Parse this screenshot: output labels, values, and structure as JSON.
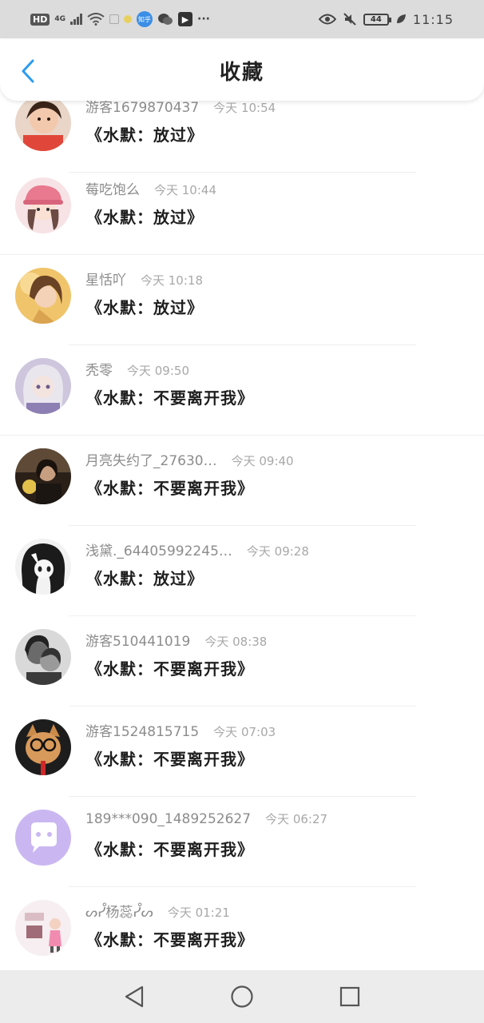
{
  "status_bar": {
    "hd": "HD",
    "network": "4G",
    "app_zhihu": "知乎",
    "more": "···",
    "battery": "44",
    "time": "11:15",
    "icons": [
      "signal-icon",
      "wifi-icon",
      "zhihu-app-icon",
      "wechat-icon",
      "douyin-icon",
      "eye-icon",
      "mute-icon",
      "battery-icon",
      "leaf-icon"
    ]
  },
  "header": {
    "title": "收藏",
    "back_icon": "chevron-left-icon",
    "accent_color": "#2b9cf0"
  },
  "items": [
    {
      "username": "游客1679870437",
      "time": "今天 10:54",
      "message": "《水默：放过》",
      "avatar": "photo-girl"
    },
    {
      "username": "莓吃饱么",
      "time": "今天 10:44",
      "message": "《水默：放过》",
      "avatar": "anime-pink-hat"
    },
    {
      "username": "星恬吖",
      "time": "今天 10:18",
      "message": "《水默：放过》",
      "avatar": "anime-golden"
    },
    {
      "username": "秃零",
      "time": "今天 09:50",
      "message": "《水默：不要离开我》",
      "avatar": "anime-silver"
    },
    {
      "username": "月亮失约了_27630…",
      "time": "今天 09:40",
      "message": "《水默：不要离开我》",
      "avatar": "photo-dark"
    },
    {
      "username": "浅黛._64405992245…",
      "time": "今天 09:28",
      "message": "《水默：放过》",
      "avatar": "anime-bw"
    },
    {
      "username": "游客510441019",
      "time": "今天 08:38",
      "message": "《水默：不要离开我》",
      "avatar": "photo-bw-couple"
    },
    {
      "username": "游客1524815715",
      "time": "今天 07:03",
      "message": "《水默：不要离开我》",
      "avatar": "cat-glasses"
    },
    {
      "username": "189***090_1489252627",
      "time": "今天 06:27",
      "message": "《水默：不要离开我》",
      "avatar": "default-chat"
    },
    {
      "username": "ᔕᓮ杨蕊ᓮᔕ",
      "time": "今天 01:21",
      "message": "《水默：不要离开我》",
      "avatar": "photo-pink-card"
    }
  ],
  "nav": {
    "back": "triangle-back-icon",
    "home": "circle-home-icon",
    "recent": "square-recent-icon"
  }
}
